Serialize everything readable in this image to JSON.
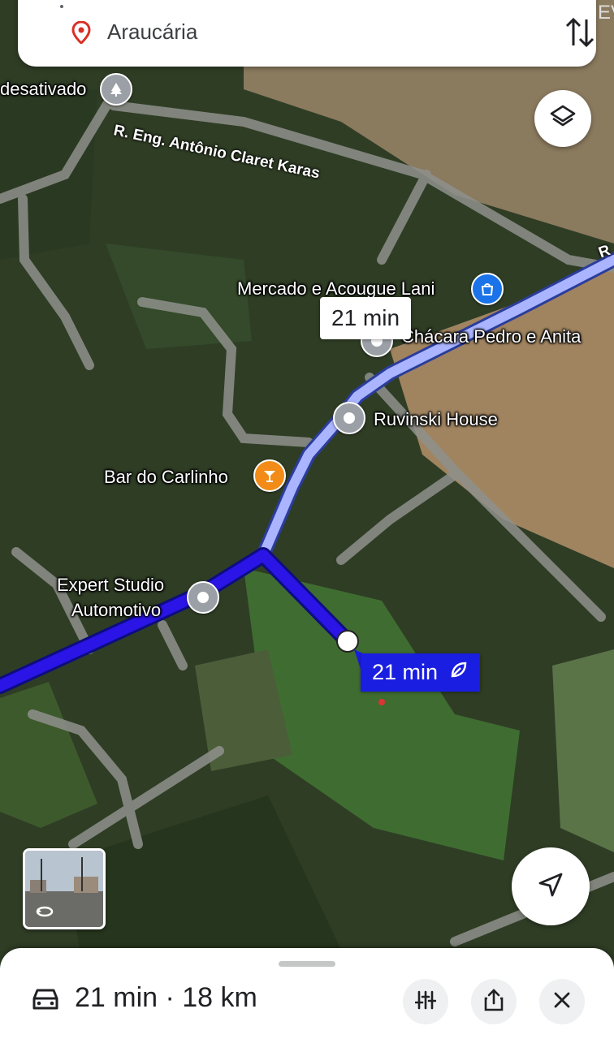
{
  "destination": {
    "label": "Araucária"
  },
  "edge_text": "EV",
  "map": {
    "street_label": "R. Eng. Antônio Claret Karas",
    "street_label_right": "R",
    "places": [
      {
        "name": "desativado"
      },
      {
        "name": "Mercado e Acougue Lani"
      },
      {
        "name": "Chácara Pedro e Anita"
      },
      {
        "name": "Ruvinski House"
      },
      {
        "name": "Bar do Carlinho"
      },
      {
        "name": "Expert Studio"
      },
      {
        "name": "Automotivo"
      }
    ],
    "route_time_alt": "21 min",
    "route_time_main": "21 min"
  },
  "colors": {
    "route_main": "#2a14e6",
    "route_alt": "#aab4ff",
    "poi_shop": "#1a73e8",
    "poi_bar": "#f28b17"
  },
  "icons": [
    "location-pin-icon",
    "swap-icon",
    "layers-icon",
    "recenter-icon",
    "leaf-icon",
    "car-icon",
    "tune-icon",
    "share-icon",
    "close-icon",
    "rotate-icon"
  ],
  "bottom_sheet": {
    "summary": "21 min · 18 km"
  }
}
